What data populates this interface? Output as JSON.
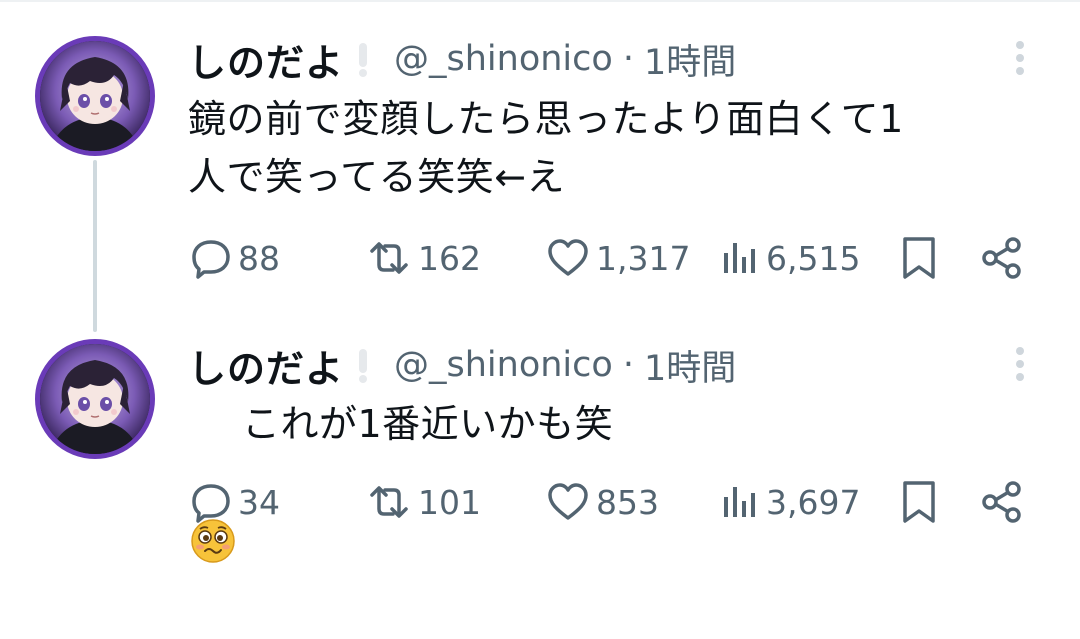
{
  "tweets": [
    {
      "display_name": "しのだよ",
      "handle": "@_shinonico",
      "separator": "·",
      "time": "1時間",
      "text": "鏡の前で変顔したら思ったより面白くて1\n人で笑ってる笑笑←え",
      "emoji": "",
      "replies": "88",
      "retweets": "162",
      "likes": "1,317",
      "views": "6,515"
    },
    {
      "display_name": "しのだよ",
      "handle": "@_shinonico",
      "separator": "·",
      "time": "1時間",
      "text": "これが1番近いかも笑",
      "emoji": "pleading-woozy-face-emoji",
      "replies": "34",
      "retweets": "101",
      "likes": "853",
      "views": "3,697"
    }
  ],
  "icons": {
    "verified": "exclamation-badge-icon",
    "more": "vertical-ellipsis-icon",
    "reply": "speech-bubble-icon",
    "retweet": "retweet-arrows-icon",
    "like": "heart-outline-icon",
    "views": "bar-chart-icon",
    "bookmark": "bookmark-outline-icon",
    "share": "share-nodes-icon"
  },
  "colors": {
    "text_primary": "#0f1419",
    "text_secondary": "#536471",
    "thread_line": "#cfd9de",
    "avatar_border": "#6a3bb8"
  }
}
